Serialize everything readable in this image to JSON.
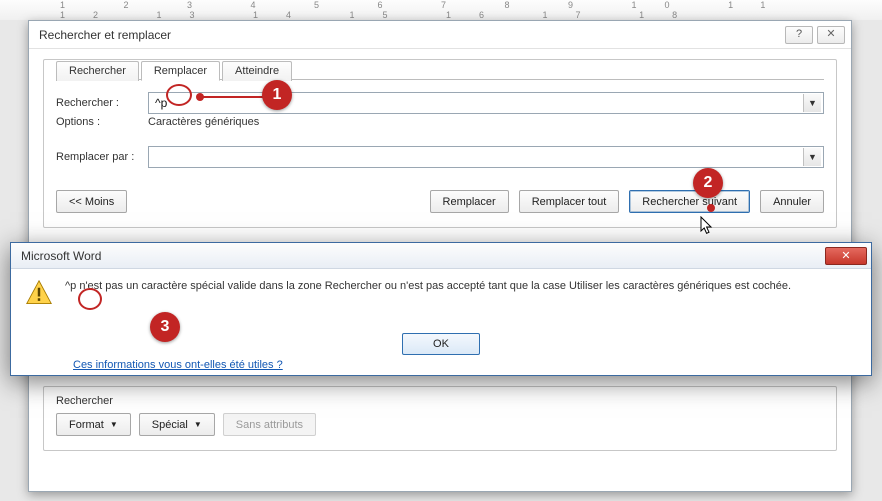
{
  "ruler_numbers": "1 2 3 4 5 6 7 8 9 10 11 12 13 14 15 16 17 18",
  "dialog": {
    "title": "Rechercher et remplacer",
    "help_glyph": "?",
    "close_glyph": "✕",
    "tabs": {
      "search": "Rechercher",
      "replace": "Remplacer",
      "goto": "Atteindre"
    },
    "labels": {
      "find": "Rechercher :",
      "options": "Options :",
      "options_value": "Caractères génériques",
      "replace_with": "Remplacer par :"
    },
    "find_value": "^p",
    "replace_value": "",
    "buttons": {
      "less": "<< Moins",
      "replace": "Remplacer",
      "replace_all": "Remplacer tout",
      "find_next": "Rechercher suivant",
      "cancel": "Annuler"
    },
    "lower": {
      "section": "Rechercher",
      "format": "Format",
      "special": "Spécial",
      "no_attrs": "Sans attributs"
    }
  },
  "msgbox": {
    "title": "Microsoft Word",
    "close_glyph": "✕",
    "text": "^p n'est pas un caractère spécial valide dans la zone Rechercher ou n'est pas accepté tant que la case Utiliser les caractères génériques est cochée.",
    "ok": "OK",
    "help_link": "Ces informations vous ont-elles été utiles ?"
  },
  "annotations": {
    "a1": "1",
    "a2": "2",
    "a3": "3"
  }
}
